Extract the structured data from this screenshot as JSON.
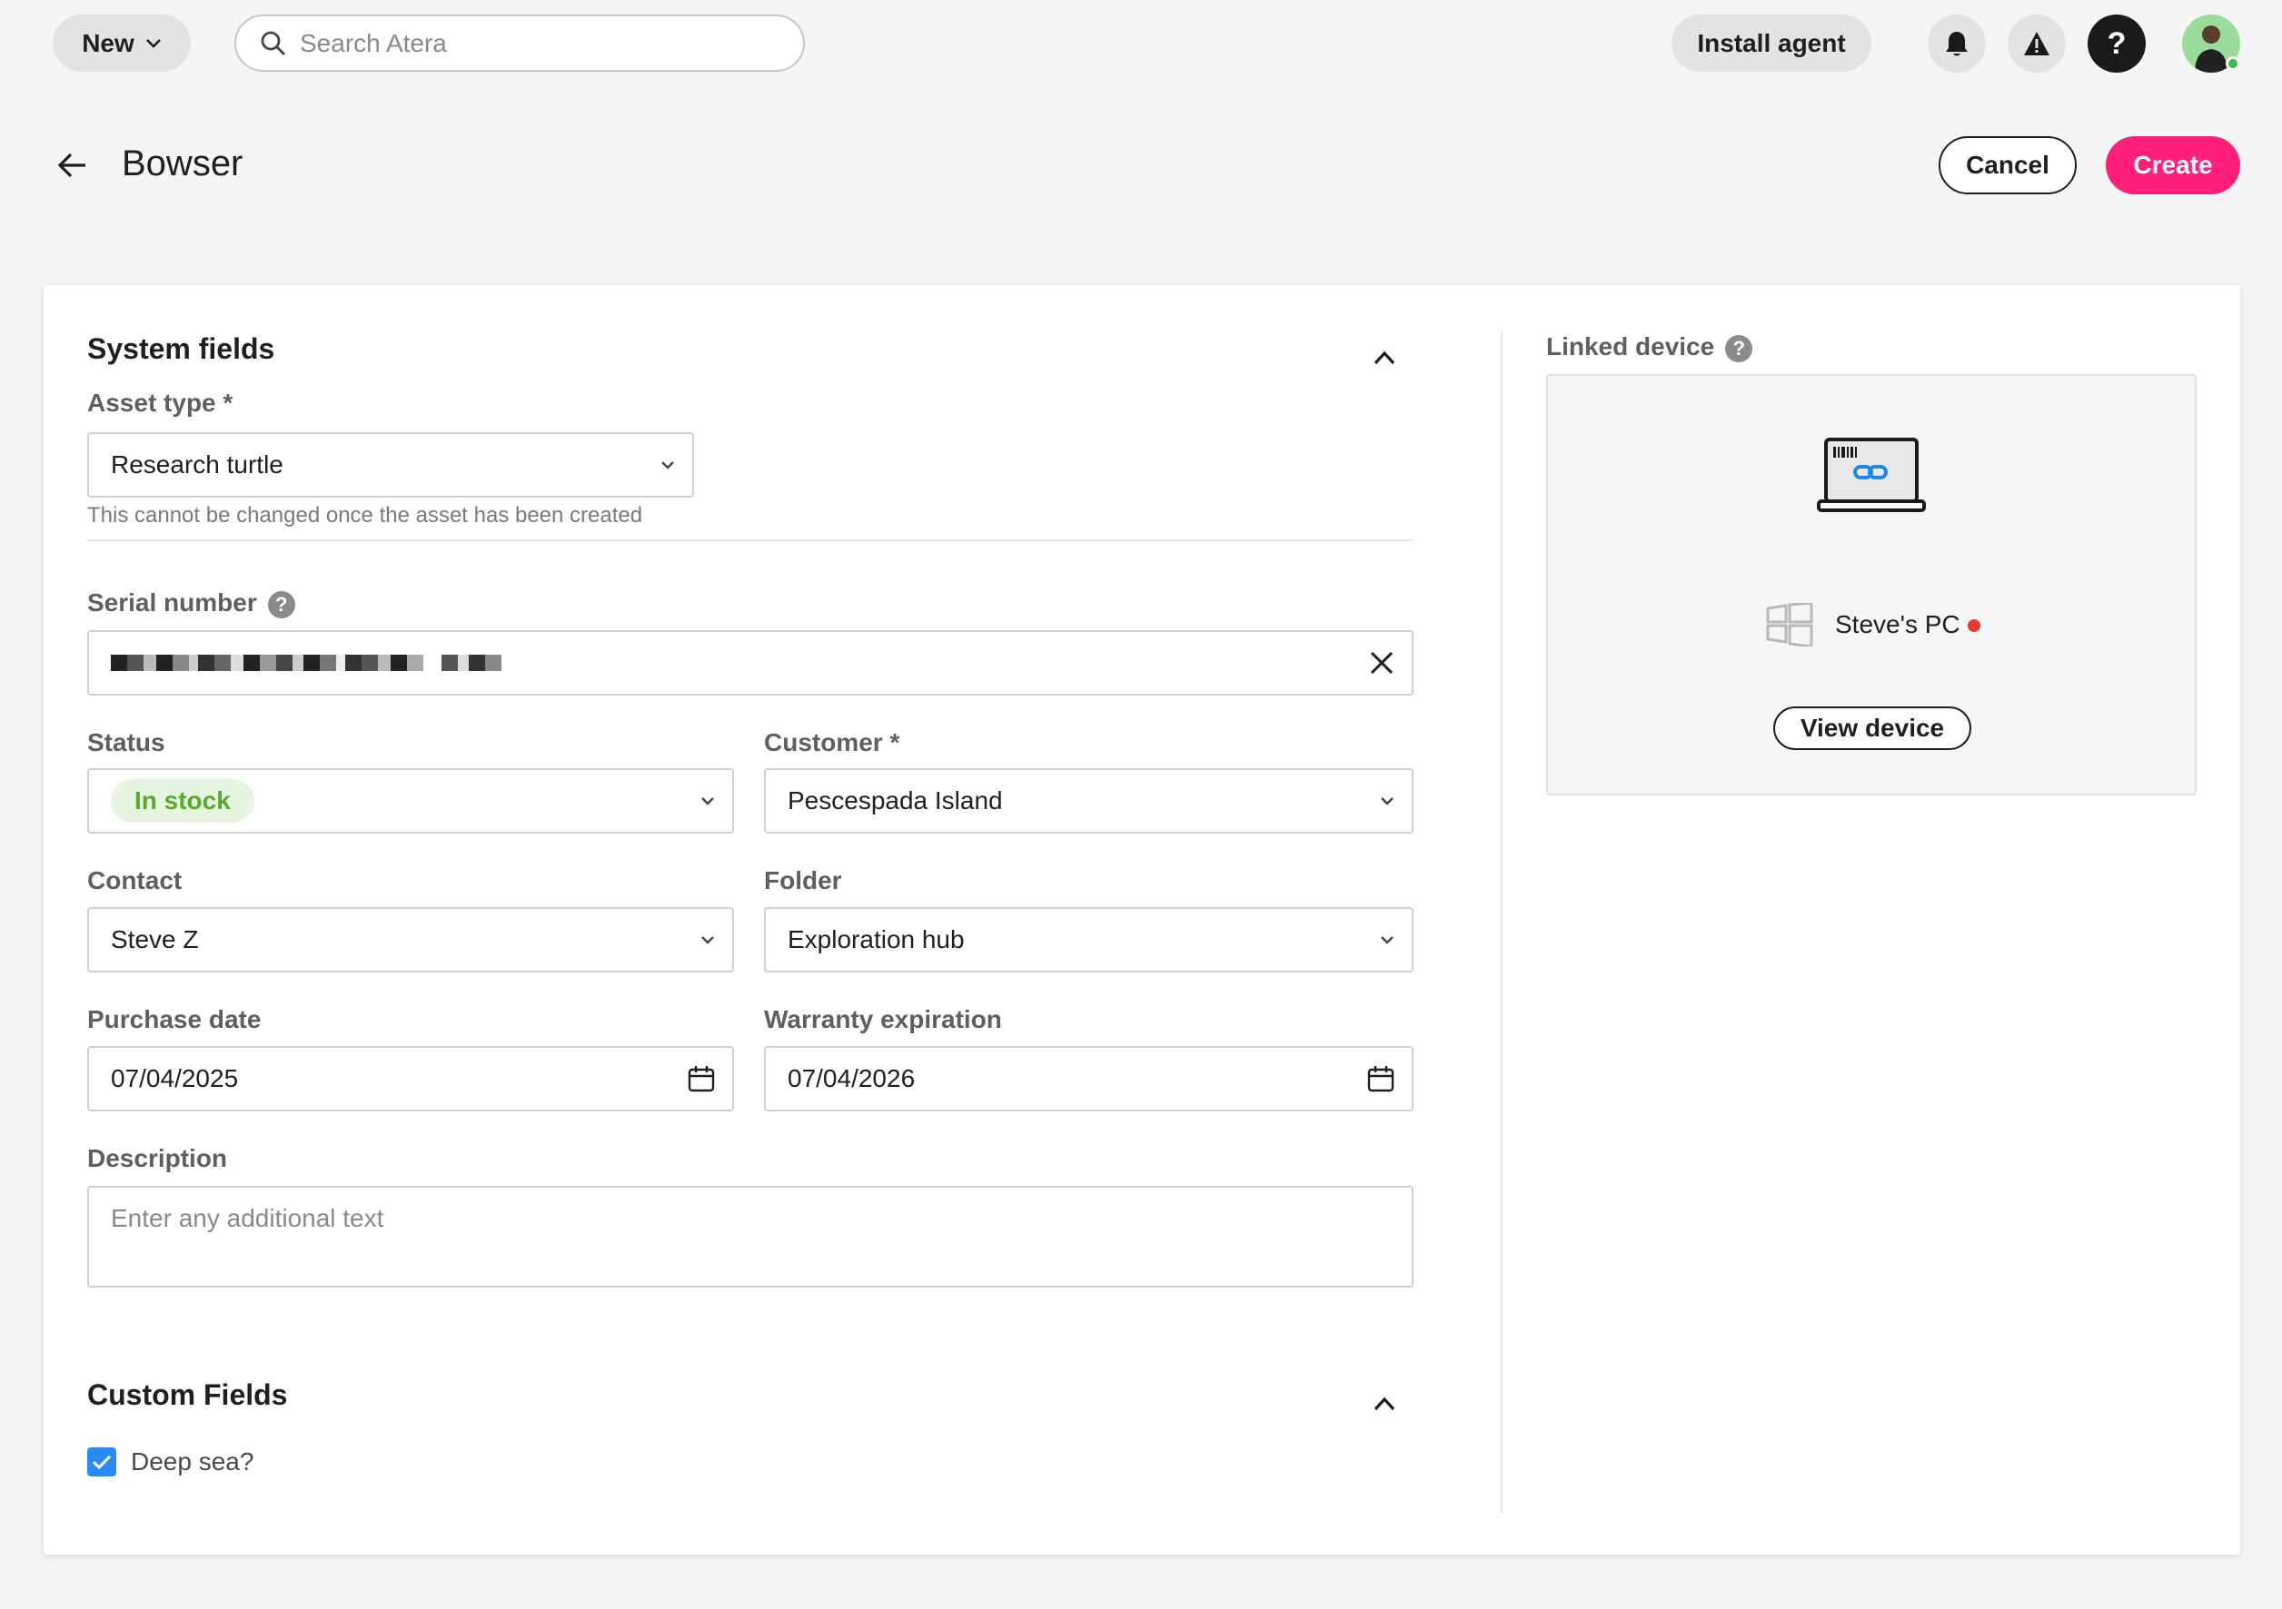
{
  "topbar": {
    "new_label": "New",
    "search_placeholder": "Search Atera",
    "install_label": "Install agent",
    "help_glyph": "?"
  },
  "header": {
    "title": "Bowser",
    "cancel_label": "Cancel",
    "create_label": "Create"
  },
  "system_fields": {
    "title": "System fields",
    "asset_type": {
      "label": "Asset type *",
      "value": "Research turtle",
      "hint": "This cannot be changed once the asset has been created"
    },
    "serial_number": {
      "label": "Serial number",
      "help": "?"
    },
    "status": {
      "label": "Status",
      "value": "In stock"
    },
    "customer": {
      "label": "Customer *",
      "value": "Pescespada Island"
    },
    "contact": {
      "label": "Contact",
      "value": "Steve Z"
    },
    "folder": {
      "label": "Folder",
      "value": "Exploration hub"
    },
    "purchase_date": {
      "label": "Purchase date",
      "value": "07/04/2025"
    },
    "warranty_expiration": {
      "label": "Warranty expiration",
      "value": "07/04/2026"
    },
    "description": {
      "label": "Description",
      "placeholder": "Enter any additional text"
    }
  },
  "custom_fields": {
    "title": "Custom Fields",
    "deep_sea": {
      "label": "Deep sea?",
      "checked": true
    }
  },
  "linked_device": {
    "label": "Linked device",
    "help": "?",
    "device_name": "Steve's PC",
    "view_label": "View device"
  },
  "colors": {
    "accent_pink": "#ff1f7a",
    "status_green": "#5aa832",
    "status_green_bg": "#e6f5e0",
    "checkbox_blue": "#2a8af6",
    "offline_red": "#e53935"
  },
  "icons": [
    "chevron-down-icon",
    "search-icon",
    "bell-icon",
    "warning-icon",
    "help-icon",
    "back-arrow-icon",
    "chevron-up-icon",
    "clear-icon",
    "calendar-icon",
    "laptop-link-icon",
    "windows-icon",
    "check-icon"
  ]
}
